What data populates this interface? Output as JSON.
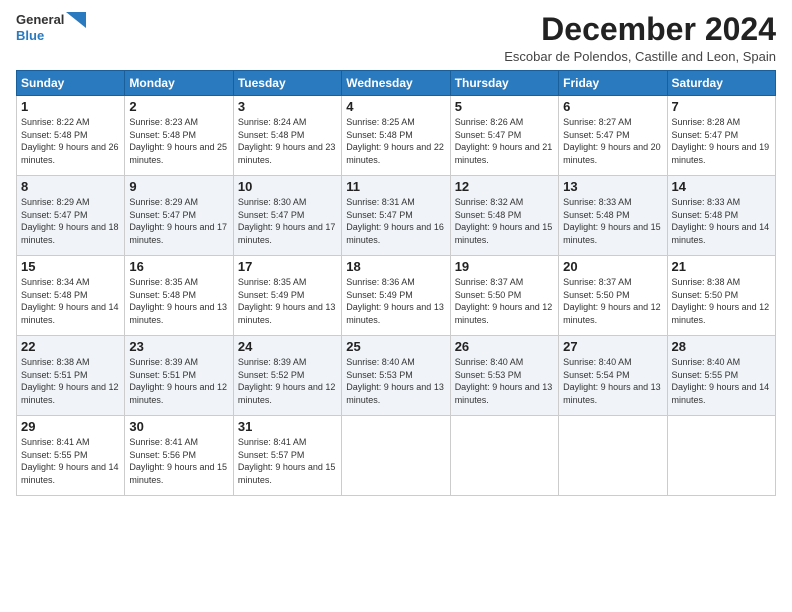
{
  "header": {
    "logo_line1": "General",
    "logo_line2": "Blue",
    "month_title": "December 2024",
    "location": "Escobar de Polendos, Castille and Leon, Spain"
  },
  "weekdays": [
    "Sunday",
    "Monday",
    "Tuesday",
    "Wednesday",
    "Thursday",
    "Friday",
    "Saturday"
  ],
  "weeks": [
    [
      {
        "day": "1",
        "sunrise": "8:22 AM",
        "sunset": "5:48 PM",
        "daylight": "9 hours and 26 minutes."
      },
      {
        "day": "2",
        "sunrise": "8:23 AM",
        "sunset": "5:48 PM",
        "daylight": "9 hours and 25 minutes."
      },
      {
        "day": "3",
        "sunrise": "8:24 AM",
        "sunset": "5:48 PM",
        "daylight": "9 hours and 23 minutes."
      },
      {
        "day": "4",
        "sunrise": "8:25 AM",
        "sunset": "5:48 PM",
        "daylight": "9 hours and 22 minutes."
      },
      {
        "day": "5",
        "sunrise": "8:26 AM",
        "sunset": "5:47 PM",
        "daylight": "9 hours and 21 minutes."
      },
      {
        "day": "6",
        "sunrise": "8:27 AM",
        "sunset": "5:47 PM",
        "daylight": "9 hours and 20 minutes."
      },
      {
        "day": "7",
        "sunrise": "8:28 AM",
        "sunset": "5:47 PM",
        "daylight": "9 hours and 19 minutes."
      }
    ],
    [
      {
        "day": "8",
        "sunrise": "8:29 AM",
        "sunset": "5:47 PM",
        "daylight": "9 hours and 18 minutes."
      },
      {
        "day": "9",
        "sunrise": "8:29 AM",
        "sunset": "5:47 PM",
        "daylight": "9 hours and 17 minutes."
      },
      {
        "day": "10",
        "sunrise": "8:30 AM",
        "sunset": "5:47 PM",
        "daylight": "9 hours and 17 minutes."
      },
      {
        "day": "11",
        "sunrise": "8:31 AM",
        "sunset": "5:47 PM",
        "daylight": "9 hours and 16 minutes."
      },
      {
        "day": "12",
        "sunrise": "8:32 AM",
        "sunset": "5:48 PM",
        "daylight": "9 hours and 15 minutes."
      },
      {
        "day": "13",
        "sunrise": "8:33 AM",
        "sunset": "5:48 PM",
        "daylight": "9 hours and 15 minutes."
      },
      {
        "day": "14",
        "sunrise": "8:33 AM",
        "sunset": "5:48 PM",
        "daylight": "9 hours and 14 minutes."
      }
    ],
    [
      {
        "day": "15",
        "sunrise": "8:34 AM",
        "sunset": "5:48 PM",
        "daylight": "9 hours and 14 minutes."
      },
      {
        "day": "16",
        "sunrise": "8:35 AM",
        "sunset": "5:48 PM",
        "daylight": "9 hours and 13 minutes."
      },
      {
        "day": "17",
        "sunrise": "8:35 AM",
        "sunset": "5:49 PM",
        "daylight": "9 hours and 13 minutes."
      },
      {
        "day": "18",
        "sunrise": "8:36 AM",
        "sunset": "5:49 PM",
        "daylight": "9 hours and 13 minutes."
      },
      {
        "day": "19",
        "sunrise": "8:37 AM",
        "sunset": "5:50 PM",
        "daylight": "9 hours and 12 minutes."
      },
      {
        "day": "20",
        "sunrise": "8:37 AM",
        "sunset": "5:50 PM",
        "daylight": "9 hours and 12 minutes."
      },
      {
        "day": "21",
        "sunrise": "8:38 AM",
        "sunset": "5:50 PM",
        "daylight": "9 hours and 12 minutes."
      }
    ],
    [
      {
        "day": "22",
        "sunrise": "8:38 AM",
        "sunset": "5:51 PM",
        "daylight": "9 hours and 12 minutes."
      },
      {
        "day": "23",
        "sunrise": "8:39 AM",
        "sunset": "5:51 PM",
        "daylight": "9 hours and 12 minutes."
      },
      {
        "day": "24",
        "sunrise": "8:39 AM",
        "sunset": "5:52 PM",
        "daylight": "9 hours and 12 minutes."
      },
      {
        "day": "25",
        "sunrise": "8:40 AM",
        "sunset": "5:53 PM",
        "daylight": "9 hours and 13 minutes."
      },
      {
        "day": "26",
        "sunrise": "8:40 AM",
        "sunset": "5:53 PM",
        "daylight": "9 hours and 13 minutes."
      },
      {
        "day": "27",
        "sunrise": "8:40 AM",
        "sunset": "5:54 PM",
        "daylight": "9 hours and 13 minutes."
      },
      {
        "day": "28",
        "sunrise": "8:40 AM",
        "sunset": "5:55 PM",
        "daylight": "9 hours and 14 minutes."
      }
    ],
    [
      {
        "day": "29",
        "sunrise": "8:41 AM",
        "sunset": "5:55 PM",
        "daylight": "9 hours and 14 minutes."
      },
      {
        "day": "30",
        "sunrise": "8:41 AM",
        "sunset": "5:56 PM",
        "daylight": "9 hours and 15 minutes."
      },
      {
        "day": "31",
        "sunrise": "8:41 AM",
        "sunset": "5:57 PM",
        "daylight": "9 hours and 15 minutes."
      },
      null,
      null,
      null,
      null
    ]
  ]
}
